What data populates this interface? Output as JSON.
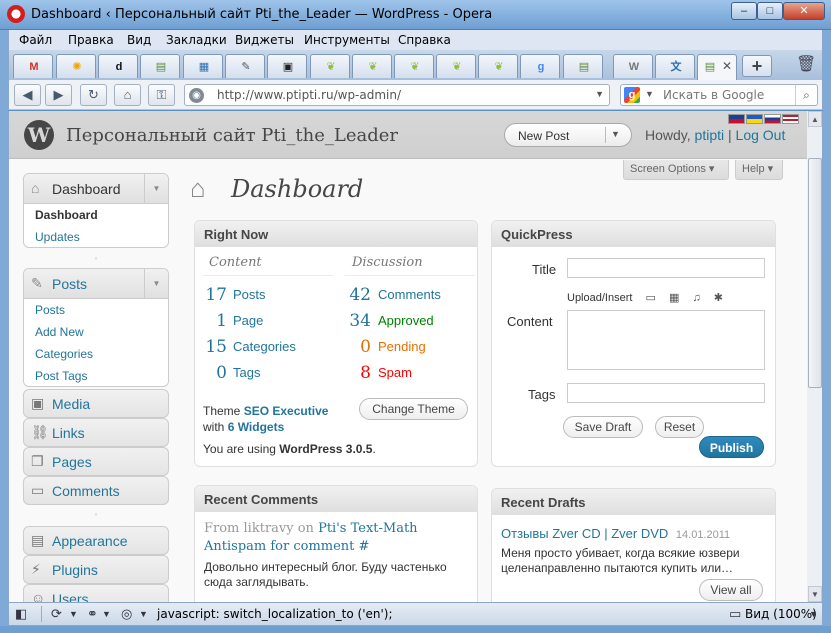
{
  "window": {
    "title": "Dashboard ‹ Персональный сайт Pti_the_Leader — WordPress - Opera",
    "minimize": "–",
    "maximize": "□",
    "close": "✕"
  },
  "menubar": [
    "Файл",
    "Правка",
    "Вид",
    "Закладки",
    "Виджеты",
    "Инструменты",
    "Справка"
  ],
  "tabs": [
    {
      "icon": "gmail-icon",
      "glyph": "M",
      "color": "#d93025"
    },
    {
      "icon": "sun-icon",
      "glyph": "✺",
      "color": "#f4a300"
    },
    {
      "icon": "d-icon",
      "glyph": "d",
      "color": "#111"
    },
    {
      "icon": "page-icon",
      "glyph": "▤",
      "color": "#5a8a3a"
    },
    {
      "icon": "grid-icon",
      "glyph": "▦",
      "color": "#2a6fb0"
    },
    {
      "icon": "pen-icon",
      "glyph": "✎",
      "color": "#555"
    },
    {
      "icon": "robot-icon",
      "glyph": "▣",
      "color": "#222"
    },
    {
      "icon": "leaf-icon",
      "glyph": "❦",
      "color": "#8fbf3a"
    },
    {
      "icon": "leaf-icon",
      "glyph": "❦",
      "color": "#8fbf3a"
    },
    {
      "icon": "leaf-icon",
      "glyph": "❦",
      "color": "#8fbf3a"
    },
    {
      "icon": "leaf-icon",
      "glyph": "❦",
      "color": "#8fbf3a"
    },
    {
      "icon": "leaf-icon",
      "glyph": "❦",
      "color": "#8fbf3a"
    },
    {
      "icon": "google-icon",
      "glyph": "g",
      "color": "#4285f4"
    },
    {
      "icon": "page-icon",
      "glyph": "▤",
      "color": "#5a8a3a"
    },
    {
      "icon": "wordpress-icon",
      "glyph": "W",
      "color": "#777"
    },
    {
      "icon": "translate-icon",
      "glyph": "文",
      "color": "#2a6fb0"
    }
  ],
  "active_tab": {
    "icon": "page-icon",
    "glyph": "▤",
    "close": "✕"
  },
  "address": {
    "url": "http://www.ptipti.ru/wp-admin/",
    "search_placeholder": "Искать в Google"
  },
  "header": {
    "site_title": "Персональный сайт Pti_the_Leader",
    "new_post": "New Post",
    "howdy": "Howdy,",
    "user": "ptipti",
    "separator": "|",
    "logout": "Log Out",
    "flags": [
      "#c8102e",
      "#ffd700",
      "#1c3f94",
      "#b22234"
    ]
  },
  "screen_options": "Screen Options ▾",
  "help": "Help ▾",
  "menu": {
    "dashboard": {
      "label": "Dashboard",
      "items": [
        "Dashboard",
        "Updates"
      ]
    },
    "posts": {
      "label": "Posts",
      "items": [
        "Posts",
        "Add New",
        "Categories",
        "Post Tags"
      ]
    },
    "media": "Media",
    "links": "Links",
    "pages": "Pages",
    "comments": "Comments",
    "appearance": "Appearance",
    "plugins": "Plugins",
    "users": "Users"
  },
  "page_title": "Dashboard",
  "right_now": {
    "title": "Right Now",
    "content_label": "Content",
    "discussion_label": "Discussion",
    "content": [
      {
        "num": "17",
        "label": "Posts"
      },
      {
        "num": "1",
        "label": "Page"
      },
      {
        "num": "15",
        "label": "Categories"
      },
      {
        "num": "0",
        "label": "Tags"
      }
    ],
    "discussion": [
      {
        "num": "42",
        "label": "Comments",
        "color": "#21759b"
      },
      {
        "num": "34",
        "label": "Approved",
        "color": "#008000"
      },
      {
        "num": "0",
        "label": "Pending",
        "color": "#e66f00"
      },
      {
        "num": "8",
        "label": "Spam",
        "color": "#ff0000"
      }
    ],
    "theme_prefix": "Theme",
    "theme_name": "SEO Executive",
    "theme_with": "with",
    "widgets": "6 Widgets",
    "change_theme": "Change Theme",
    "version_prefix": "You are using",
    "version": "WordPress 3.0.5",
    "version_suffix": "."
  },
  "quickpress": {
    "title": "QuickPress",
    "title_label": "Title",
    "upload_label": "Upload/Insert",
    "content_label": "Content",
    "tags_label": "Tags",
    "save_draft": "Save Draft",
    "reset": "Reset",
    "publish": "Publish"
  },
  "recent_comments": {
    "title": "Recent Comments",
    "from": "From liktravy on",
    "post_link": "Pti's Text-Math Antispam for comment #",
    "text": "Довольно интересный блог. Буду частенько сюда заглядывать."
  },
  "recent_drafts": {
    "title": "Recent Drafts",
    "draft_title": "Отзывы Zver CD | Zver DVD",
    "date": "14.01.2011",
    "excerpt": "Меня просто убивает, когда всякие юзвери целенаправленно пытаются купить или…",
    "view_all": "View all"
  },
  "statusbar": {
    "status_text": "javascript: switch_localization_to ('en');",
    "zoom": "Вид (100%)"
  }
}
